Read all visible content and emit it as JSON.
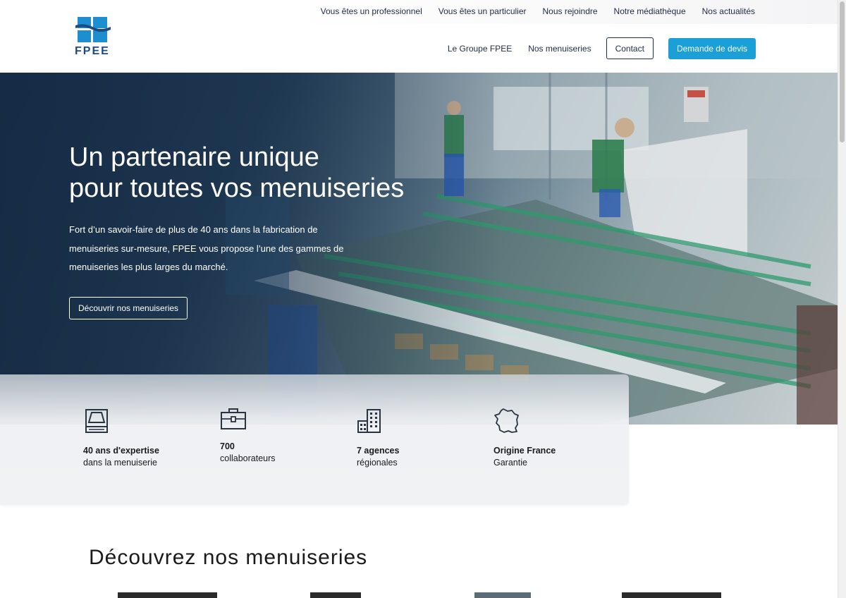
{
  "brand": {
    "name": "FPEE",
    "primary_color": "#1d4a82",
    "accent_color": "#1a9fd6"
  },
  "topnav": {
    "items": [
      {
        "label": "Vous êtes un professionnel"
      },
      {
        "label": "Vous êtes un particulier"
      },
      {
        "label": "Nous rejoindre"
      },
      {
        "label": "Notre médiathèque"
      },
      {
        "label": "Nos actualités"
      }
    ]
  },
  "mainnav": {
    "items": [
      {
        "label": "Le Groupe FPEE"
      },
      {
        "label": "Nos menuiseries"
      }
    ],
    "contact_label": "Contact",
    "quote_label": "Demande de devis"
  },
  "hero": {
    "title_line1": "Un partenaire unique",
    "title_line2": "pour toutes vos menuiseries",
    "description": "Fort d’un savoir-faire de plus de 40 ans dans la fabrication de menuiseries sur-mesure, FPEE vous propose l’une des gammes de menuiseries les plus larges du marché.",
    "cta_label": "Découvrir nos menuiseries"
  },
  "stats": [
    {
      "icon": "window-icon",
      "bold": "40 ans d'expertise",
      "light": "dans la menuiserie"
    },
    {
      "icon": "briefcase-icon",
      "bold": "700",
      "light": "collaborateurs"
    },
    {
      "icon": "building-icon",
      "bold": "7 agences",
      "light": "régionales"
    },
    {
      "icon": "france-map-icon",
      "bold": "Origine France",
      "light": "Garantie"
    }
  ],
  "section": {
    "title": "Découvrez nos menuiseries"
  }
}
